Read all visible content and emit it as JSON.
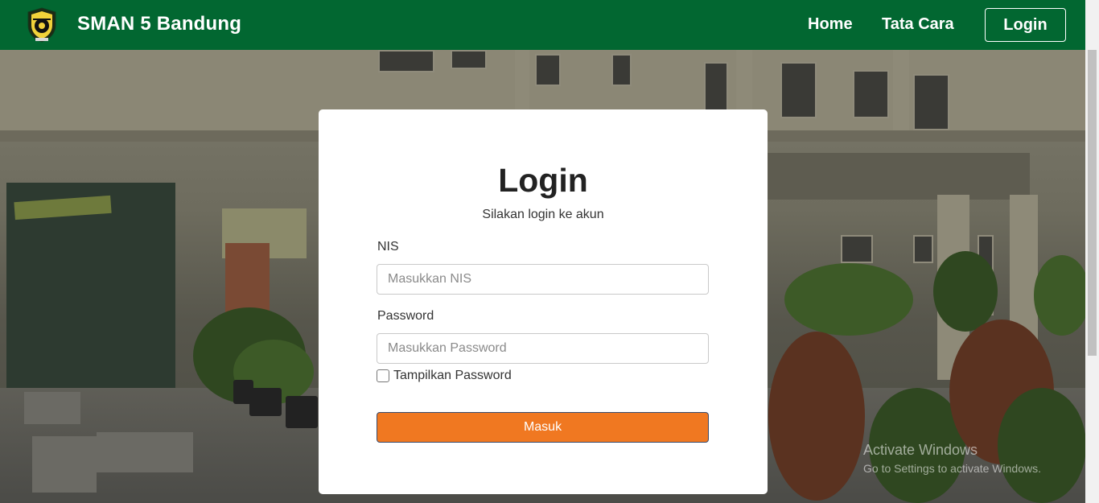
{
  "navbar": {
    "brand": "SMAN 5 Bandung",
    "links": [
      "Home",
      "Tata Cara"
    ],
    "login_button": "Login",
    "logo_icon": "school-emblem-icon",
    "background_color": "#026731"
  },
  "login_card": {
    "title": "Login",
    "subtitle": "Silakan login ke akun",
    "nis_label": "NIS",
    "nis_placeholder": "Masukkan NIS",
    "nis_value": "",
    "password_label": "Password",
    "password_placeholder": "Masukkan Password",
    "password_value": "",
    "show_password_label": "Tampilkan Password",
    "show_password_checked": false,
    "submit_label": "Masuk",
    "submit_color": "#f07821"
  },
  "watermark": {
    "line1": "Activate Windows",
    "line2": "Go to Settings to activate Windows."
  }
}
